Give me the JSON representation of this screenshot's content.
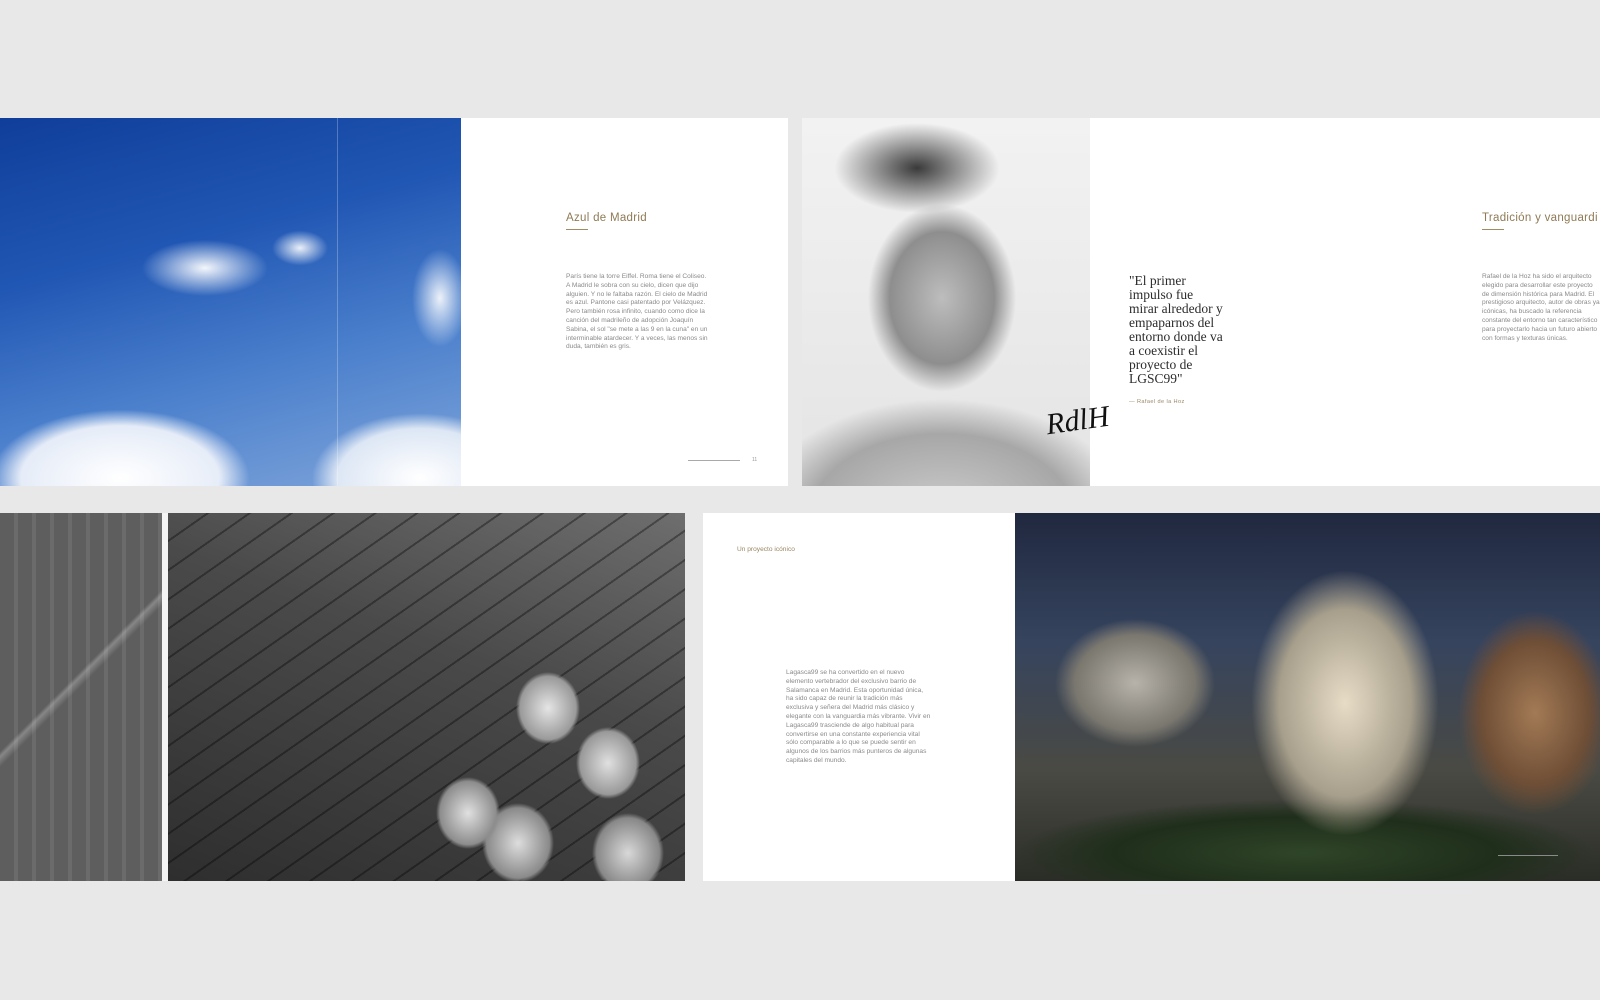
{
  "spreads": {
    "azul": {
      "title": "Azul de Madrid",
      "body": "París tiene la torre Eiffel. Roma tiene el Coliseo. A Madrid le sobra con su cielo, dicen que dijo alguien. Y no le faltaba razón. El cielo de Madrid es azul. Pantone casi patentado por Velázquez. Pero también rosa infinito, cuando como dice la canción del madrileño de adopción Joaquín Sabina, el sol \"se mete a las 9 en la cuna\" en un interminable atardecer. Y a veces, las menos sin duda, también es gris.",
      "page_number": "11"
    },
    "tradicion": {
      "quote": "\"El primer impulso fue mirar alrededor y empaparnos del entorno donde va a coexistir el proyecto de LGSC99\"",
      "credit": "— Rafael de la Hoz",
      "title": "Tradición y vanguardi",
      "body": "Rafael de la Hoz ha sido el arquitecto elegido para desarrollar este proyecto de dimensión histórica para Madrid. El prestigioso arquitecto, autor de obras ya icónicas, ha buscado la referencia constante del entorno tan característico para proyectarlo hacia un futuro abierto con formas y texturas únicas."
    },
    "iconico": {
      "label": "Un proyecto icónico",
      "body": "Lagasca99 se ha convertido en el nuevo elemento vertebrador del exclusivo barrio de Salamanca en Madrid. Esta oportunidad única, ha sido capaz de reunir la tradición más exclusiva y señera del Madrid más clásico y elegante con la vanguardia más vibrante. Vivir en Lagasca99 trasciende de algo habitual para convertirse en una constante experiencia vital sólo comparable a lo que se puede sentir en algunos de los barrios más punteros de algunas capitales del mundo."
    }
  },
  "colors": {
    "background": "#e8e8e8",
    "accent": "#8f7a55",
    "text": "#8a8a8a"
  }
}
